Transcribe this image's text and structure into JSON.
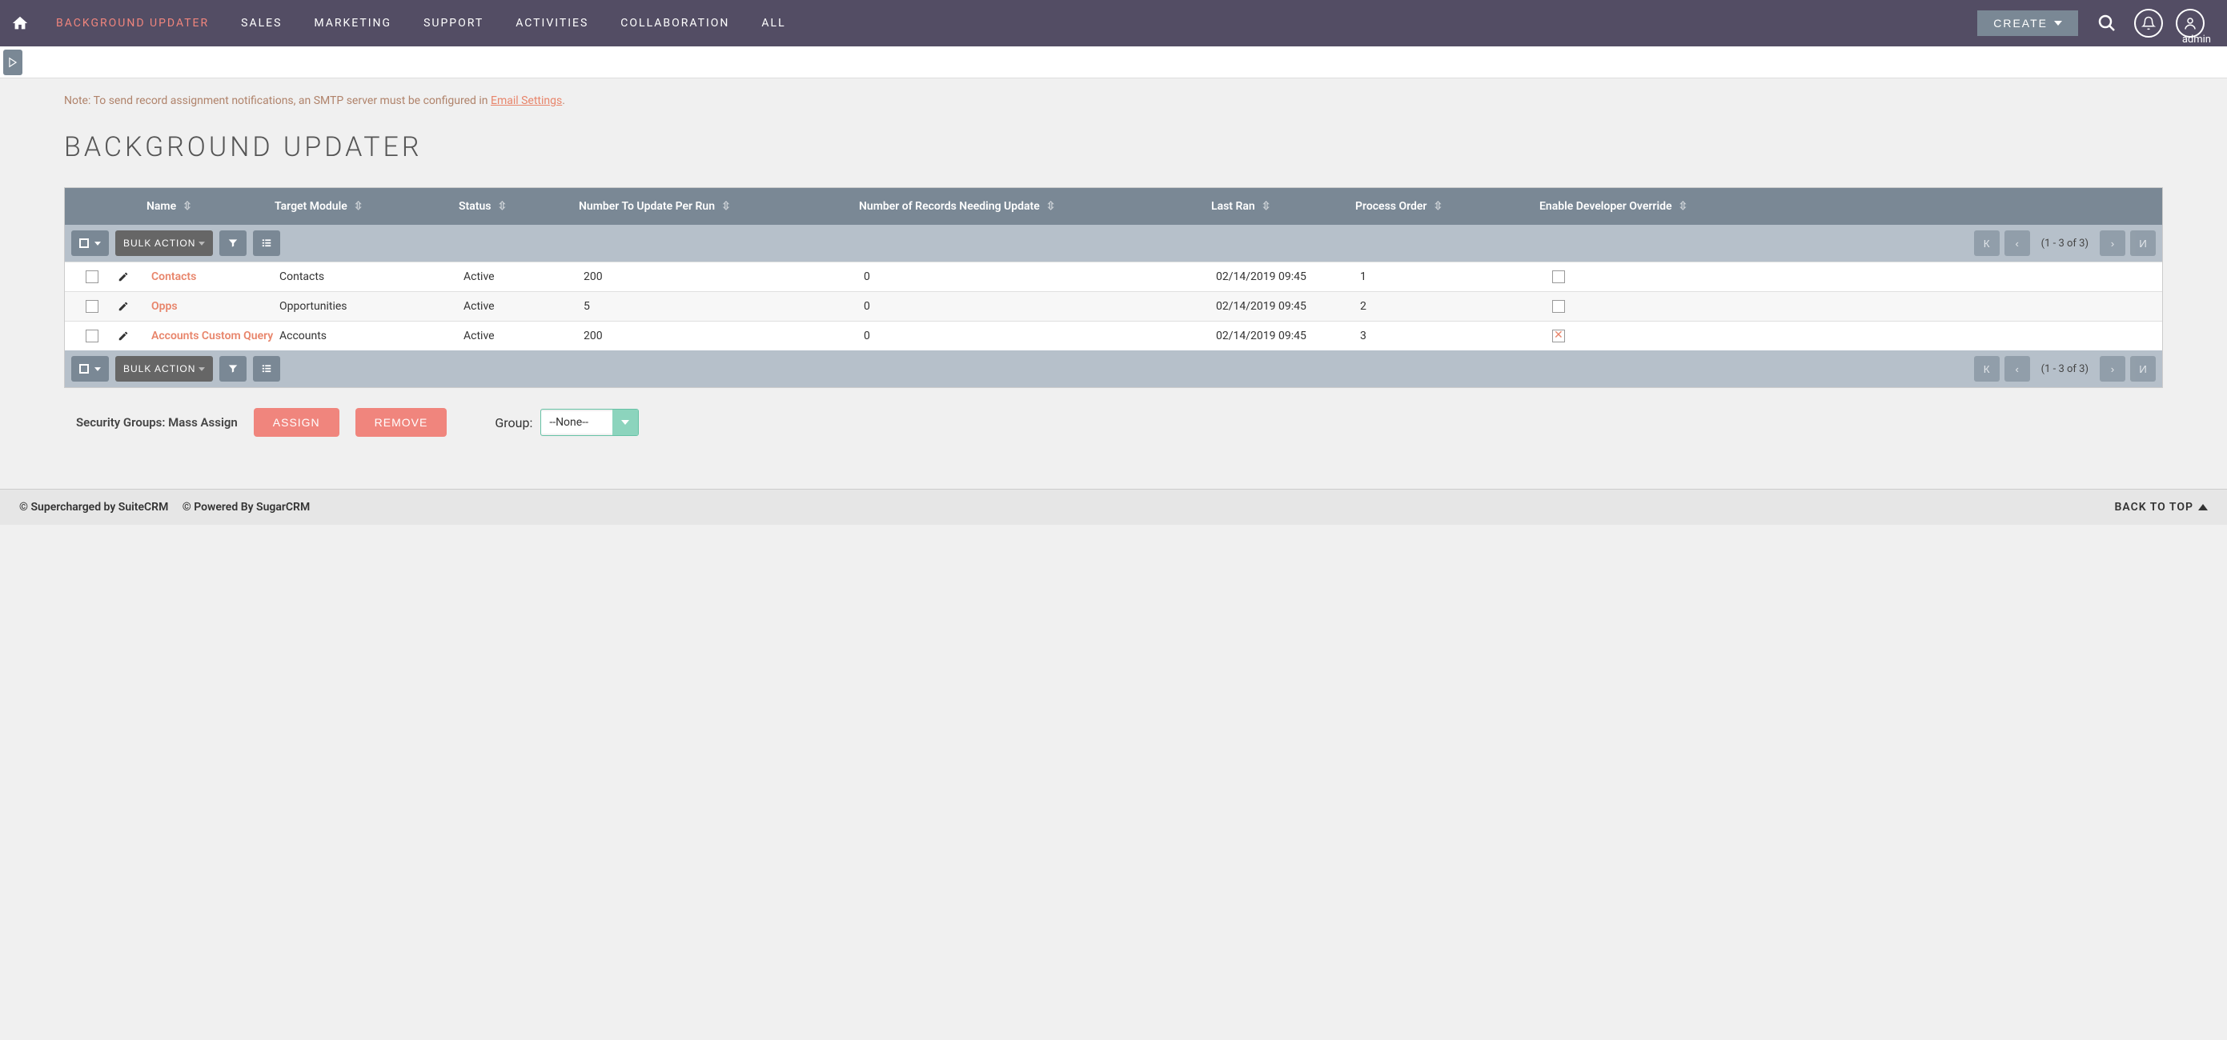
{
  "nav": {
    "items": [
      "BACKGROUND UPDATER",
      "SALES",
      "MARKETING",
      "SUPPORT",
      "ACTIVITIES",
      "COLLABORATION",
      "ALL"
    ],
    "create": "CREATE",
    "user": "admin"
  },
  "note": {
    "prefix": "Note: To send record assignment notifications, an SMTP server must be configured in ",
    "link": "Email Settings",
    "suffix": "."
  },
  "page_title": "BACKGROUND UPDATER",
  "columns": [
    "Name",
    "Target Module",
    "Status",
    "Number To Update Per Run",
    "Number of Records Needing Update",
    "Last Ran",
    "Process Order",
    "Enable Developer Override"
  ],
  "actionbar": {
    "bulk": "BULK ACTION",
    "range": "(1 - 3 of 3)"
  },
  "rows": [
    {
      "name": "Contacts",
      "target": "Contacts",
      "status": "Active",
      "num_update": "200",
      "needing": "0",
      "last_ran": "02/14/2019 09:45",
      "process": "1",
      "override": false
    },
    {
      "name": "Opps",
      "target": "Opportunities",
      "status": "Active",
      "num_update": "5",
      "needing": "0",
      "last_ran": "02/14/2019 09:45",
      "process": "2",
      "override": false
    },
    {
      "name": "Accounts Custom Query",
      "target": "Accounts",
      "status": "Active",
      "num_update": "200",
      "needing": "0",
      "last_ran": "02/14/2019 09:45",
      "process": "3",
      "override": true
    }
  ],
  "mass": {
    "label": "Security Groups: Mass Assign",
    "assign": "ASSIGN",
    "remove": "REMOVE",
    "group_label": "Group:",
    "group_value": "--None--"
  },
  "footer": {
    "left1": "© Supercharged by SuiteCRM",
    "left2": "© Powered By SugarCRM",
    "back": "BACK TO TOP"
  }
}
